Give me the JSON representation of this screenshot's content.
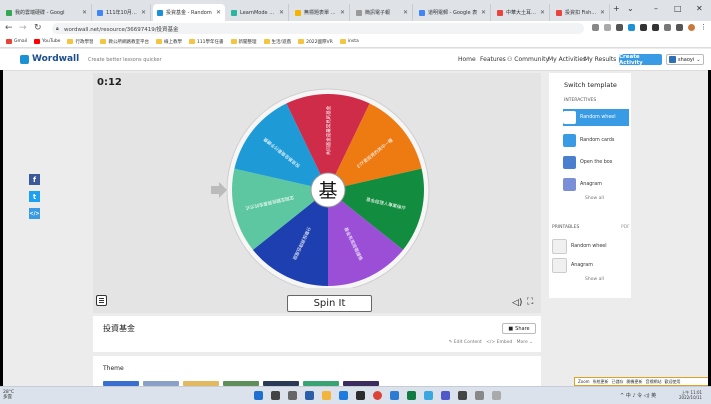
{
  "browser": {
    "tabs": [
      {
        "label": "我的雲端硬碟 - Googl",
        "color": "#34a853"
      },
      {
        "label": "111年10月25日社會",
        "color": "#4285f4"
      },
      {
        "label": "投資基金 - Random",
        "color": "#1b91d6",
        "active": true
      },
      {
        "label": "LearnMode 學習吧",
        "color": "#2bb5a0"
      },
      {
        "label": "無標題表單 - Google 表",
        "color": "#f4b400"
      },
      {
        "label": "簡訊電子報",
        "color": "#999999"
      },
      {
        "label": "道明電郵 - Google 表",
        "color": "#4285f4"
      },
      {
        "label": "中華大土耳其語言吧",
        "color": "#e8453c"
      },
      {
        "label": "投資扣 Fish Learn",
        "color": "#e8453c"
      }
    ],
    "new_tab": "+",
    "url": "wordwall.net/resource/36697419/投資基金",
    "bookmarks": [
      {
        "label": "Gmail",
        "icon": "gmail-icon"
      },
      {
        "label": "YouTube",
        "icon": "youtube-icon"
      },
      {
        "label": "行政學習",
        "icon": "folder-icon"
      },
      {
        "label": "教公所網路教室平台",
        "icon": "folder-icon"
      },
      {
        "label": "線上教學",
        "icon": "folder-icon"
      },
      {
        "label": "111學年任書",
        "icon": "folder-icon"
      },
      {
        "label": "新聞整理",
        "icon": "folder-icon"
      },
      {
        "label": "生活/遊戲",
        "icon": "folder-icon"
      },
      {
        "label": "2022國際VR",
        "icon": "folder-icon"
      },
      {
        "label": "insta",
        "icon": "folder-icon"
      }
    ]
  },
  "site": {
    "logo": "Wordwall",
    "tagline": "Create better lessons quicker",
    "nav": [
      "Home",
      "Features",
      "Community",
      "My Activities",
      "My Results"
    ],
    "create_button": "Create Activity",
    "user": "shaoyi"
  },
  "activity": {
    "timer": "0:12",
    "center_text": "基",
    "segments": [
      {
        "label": "共同基金是最常見的基金",
        "color": "#cf2c4a"
      },
      {
        "label": "ETF是投資的其中一種",
        "color": "#ee7a12"
      },
      {
        "label": "基金經理人專業操作",
        "color": "#128c3e"
      },
      {
        "label": "基金有風險需謹慎",
        "color": "#9a4fd6"
      },
      {
        "label": "分散投資降低風險",
        "color": "#1e3fb0"
      },
      {
        "label": "定期定額投資基金的方式",
        "color": "#5cc7a0"
      },
      {
        "label": "投資基金需要付手續費",
        "color": "#1e9ad6"
      }
    ],
    "spin_button": "Spin It",
    "title": "投資基金",
    "share_button": "Share",
    "actions": [
      "Edit Content",
      "Embed",
      "More"
    ],
    "theme_label": "Theme"
  },
  "switch_template": {
    "title": "Switch template",
    "interactives_label": "INTERACTIVES",
    "interactives": [
      {
        "label": "Random wheel",
        "selected": true
      },
      {
        "label": "Random cards"
      },
      {
        "label": "Open the box"
      },
      {
        "label": "Anagram"
      }
    ],
    "show_all": "Show all",
    "printables_label": "PRINTABLES",
    "pdf_label": "PDF",
    "printables": [
      {
        "label": "Random wheel"
      },
      {
        "label": "Anagram"
      }
    ]
  },
  "social": [
    "f",
    "t",
    "</>"
  ],
  "taskbar": {
    "weather_temp": "28°C",
    "weather_desc": "多雲",
    "time": "上午 11:01",
    "date": "2022/10/11",
    "tray": "^ 中 ♪ 令 ◁) 英"
  },
  "popup": {
    "items": [
      "Zoom",
      "系統更新",
      "已儲存",
      "開機更新",
      "音標網站",
      "歡迎使用"
    ]
  }
}
